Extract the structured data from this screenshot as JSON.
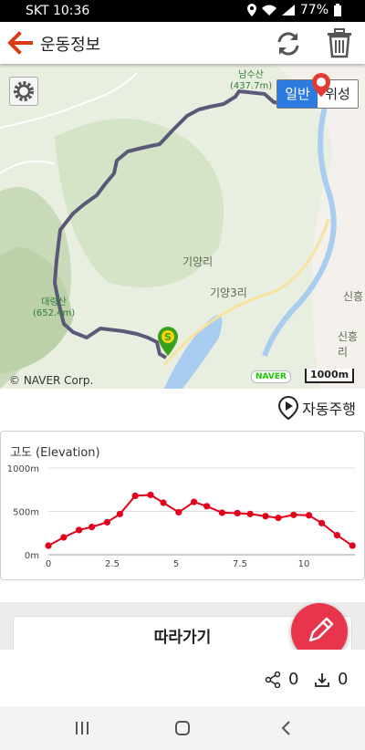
{
  "status_bar": {
    "carrier": "SKT 10:36",
    "battery": "77%"
  },
  "header": {
    "title": "운동정보",
    "back_icon": "arrow-left-icon",
    "refresh_icon": "refresh-icon",
    "delete_icon": "trash-icon"
  },
  "map": {
    "map_types": [
      "일반",
      "위성"
    ],
    "labels": {
      "namsu": "남수산",
      "namsu_h": "(437.7m)",
      "daeryeong": "대령산",
      "daeryeong_h": "(652.4m)",
      "giyangri": "기양리",
      "giyang3ri": "기양3리",
      "sinheung1": "신흥",
      "sinheung2": "신흥리"
    },
    "copyright": "© NAVER Corp.",
    "naver_badge": "NAVER",
    "scale": "1000m",
    "start_marker": "S"
  },
  "auto_drive": {
    "label": "자동주행",
    "icon": "play-pin-icon"
  },
  "chart_data": {
    "type": "line",
    "title": "고도 (Elevation)",
    "xlabel": "",
    "ylabel": "",
    "x": [
      0,
      0.6,
      1.2,
      1.7,
      2.3,
      2.8,
      3.4,
      4.0,
      4.5,
      5.1,
      5.7,
      6.2,
      6.8,
      7.4,
      7.9,
      8.5,
      9.0,
      9.6,
      10.2,
      10.7,
      11.3,
      11.9
    ],
    "values": [
      105,
      200,
      285,
      320,
      375,
      470,
      680,
      690,
      600,
      490,
      610,
      560,
      485,
      480,
      470,
      445,
      425,
      460,
      455,
      365,
      225,
      105
    ],
    "ylim": [
      0,
      1000
    ],
    "xlim": [
      0,
      12
    ],
    "xticks": [
      "0",
      "2.5",
      "5",
      "7.5",
      "10"
    ],
    "yticks": [
      "0m",
      "500m",
      "1000m"
    ],
    "color": "#e3001b",
    "grid": true
  },
  "follow_button": "따라가기",
  "fab_icon": "pencil-icon",
  "stats": {
    "share_count": "0",
    "download_count": "0",
    "share_icon": "share-icon",
    "download_icon": "download-icon"
  },
  "nav_bar": {
    "recent_icon": "recent-apps-icon",
    "home_icon": "home-icon",
    "back_icon": "nav-back-icon"
  }
}
